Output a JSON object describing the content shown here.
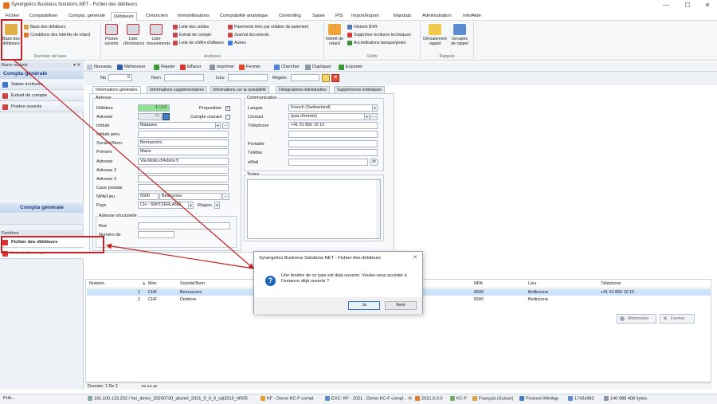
{
  "window": {
    "title": "Synergetics Business Solutions.NET - Fichier des débiteurs",
    "min": "—",
    "max": "☐",
    "close": "✕"
  },
  "menu": [
    "Fichier",
    "Comptabiliser",
    "Compta. générale",
    "Débiteurs",
    "Créanciers",
    "Immobilisations",
    "Comptabilité analytique",
    "Controlling",
    "Saisie",
    "PIS",
    "Import/Export",
    "Mandats",
    "Administration",
    "Info/Aide"
  ],
  "menu_active_index": 3,
  "ribbon": {
    "base": {
      "big": "Base des débiteurs",
      "small": [
        "Base des débiteurs",
        "Conditions des intérêts de retard"
      ],
      "group": "Données de base"
    },
    "analyses": {
      "big": [
        "Postes ouverts",
        "Liste d'échéance",
        "Liste mouvements"
      ],
      "small1": [
        "Liste des soldes",
        "Extrait de compte",
        "Liste de chiffre d'affaires"
      ],
      "small2": [
        "Paiements triés par rélation de paiement",
        "Journal documents",
        "Autres"
      ],
      "group": "Analyses"
    },
    "outils": {
      "big": "Intérêt de retard",
      "small": [
        "Historie BVR",
        "Supprimer écritures techniques",
        "Accréditations banque/poste"
      ],
      "group": "Outils"
    },
    "rappels": {
      "big": [
        "Déroulement rappel",
        "Groupes de rappel"
      ],
      "group": "Rappels"
    }
  },
  "sidebar": {
    "header": "Barre outlook",
    "header_controls": "▾ ✕",
    "title": "Compta générale",
    "items": [
      "Saisie écritures",
      "Extrait de compte",
      "Postes ouverts"
    ],
    "bottom_title": "Compta générale",
    "section2_header": "Fenêtres",
    "windows": [
      "Fichier des débiteurs",
      "Extrait de compte"
    ]
  },
  "toolbar": [
    "Nouveau",
    "Mémoriser",
    "Rejeter",
    "Effacer",
    "Imprimer",
    "Fermer",
    "Chercher",
    "Dupliquer",
    "Exporter"
  ],
  "search": {
    "no_label": "No",
    "no_value": "0",
    "nom_label": "Nom",
    "lieu_label": "Lieu",
    "region_label": "Région"
  },
  "tabs": [
    "Informations générales",
    "Informations supplémentaires",
    "Informations sur la solvabilité",
    "Désignations individuelles",
    "Suppléments individuels"
  ],
  "adresse": {
    "group": "Adresse",
    "debiteur_label": "Débiteur",
    "debiteur_value": "1",
    "debiteur_currency": "CHF",
    "adresse_label": "Adresse",
    "adresse_value": "70",
    "proposition_label": "Proposition",
    "compte_courant_label": "Compte courant",
    "intitule_label": "Intitulé",
    "intitule_value": "Madame",
    "intitule_pers_label": "Intitulé pers.",
    "societe_label": "Société/Nom",
    "societe_value": "Bernasconi",
    "prenom_label": "Prénom",
    "prenom_value": "Maria",
    "adresse1_label": "Adresse",
    "adresse1_value": "Via Motto d'Arbino 5",
    "adresse2_label": "Adresse 2",
    "adresse3_label": "Adresse 3",
    "case_label": "Case postale",
    "npa_label": "NPA/Lieu",
    "npa_value": "6500",
    "lieu_value": "Bellinzona",
    "pays_label": "Pays",
    "pays_value": "CH - SWITZERLAND",
    "region_label": "Région",
    "struct_group": "Adresse structurelle",
    "rue_label": "Rue",
    "numero_label": "Numéro de"
  },
  "communication": {
    "group": "Communication",
    "langue_label": "Langue",
    "langue_value": "French (Switzerland)",
    "contact_label": "Contact",
    "contact_value": "(pas d'entrée)",
    "telephone_label": "Téléphone",
    "telephone_value": "+41 91 850 10 10",
    "portable_label": "Portable",
    "telefax_label": "Téléfax",
    "email_label": "eMail",
    "textes_label": "Textes"
  },
  "grid": {
    "headers": [
      "Numéro",
      "Mon",
      "Société/Nom",
      "NPA",
      "Lieu",
      "Téléphone"
    ],
    "rows": [
      {
        "num": "1",
        "mon": "CHF",
        "nom": "Bernasconi",
        "npa": "6500",
        "lieu": "Bellinzona",
        "tel": "+41 91 850 10 10"
      },
      {
        "num": "2",
        "mon": "CHF",
        "nom": "Debitore",
        "npa": "6500",
        "lieu": "Bellinzona",
        "tel": ""
      }
    ],
    "sort_marker": "▲",
    "pager": "Donnée: 1 De 2",
    "pager_nav": "◂◂ ◂ ▸ ▸▸",
    "memoriser": "Mémoriser",
    "fermer": "Fermer"
  },
  "dialog": {
    "title": "Synergetics Business Solutions.NET - Fichier des débiteurs",
    "message": "Une fenêtre de ce type est déjà ouverte. Voulez-vous accéder à l'instance déjà ouverte ?",
    "yes": "Ja",
    "no": "Nein",
    "close": "✕",
    "icon": "?"
  },
  "status": {
    "left": "Prêt...",
    "items": [
      "191.100.123.202 / hei_demo_20200730_sbsnet_2021_0_0_0_sql2019_hf005",
      "KF - Demo KC-F compl.",
      "EXC: KF - 2021 - Demo KC-F compl. - H",
      "2021.0.0.0",
      "KC-F",
      "Français (Suisse)",
      "Finance.WinApp",
      "1743x982",
      "140 988 408 bytes"
    ]
  },
  "colors": {
    "accent": "#1b3f7a",
    "selection": "#cde3fb",
    "arrow": "#c42323",
    "green_field": "#8fe28f"
  }
}
